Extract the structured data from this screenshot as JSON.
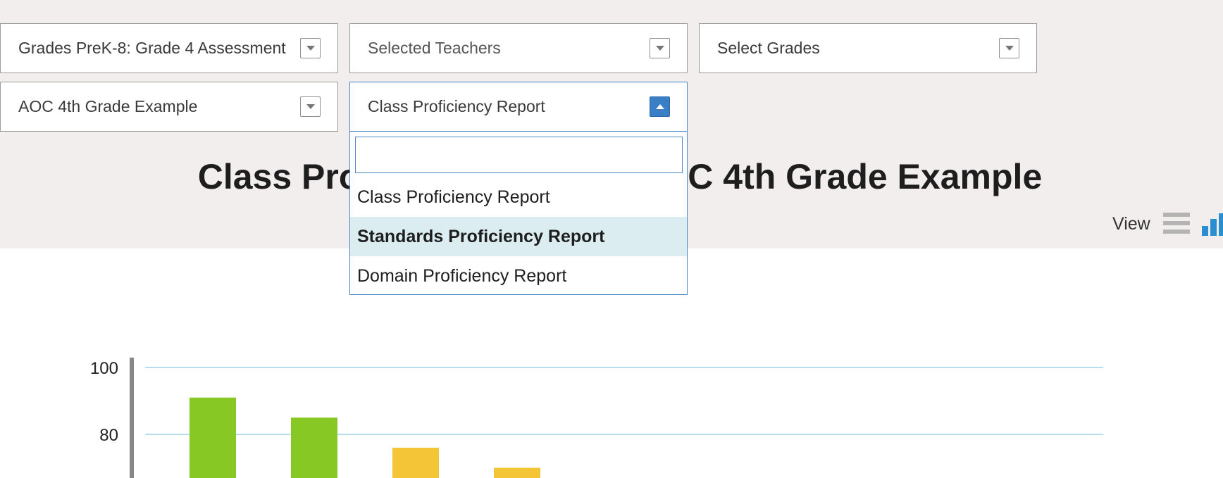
{
  "filters": {
    "assessment": "Grades PreK-8: Grade 4 Assessment",
    "teachers": "Selected Teachers",
    "grades": "Select Grades",
    "class": "AOC 4th Grade Example",
    "report": "Class Proficiency Report"
  },
  "page_title": "Class Proficiency Report: AOC 4th Grade Example",
  "view": {
    "label": "View"
  },
  "report_dropdown": {
    "search_value": "",
    "options": [
      {
        "label": "Class Proficiency Report"
      },
      {
        "label": "Standards Proficiency Report"
      },
      {
        "label": "Domain Proficiency Report"
      }
    ],
    "highlighted_index": 1
  },
  "colors": {
    "band_bg": "#f1eeed",
    "accent_blue": "#3a7fc6",
    "gridline": "#9fd6e8",
    "bar_green": "#87c824",
    "bar_yellow": "#f4c637",
    "axis": "#888888",
    "icon_gray": "#b4b4b4",
    "icon_blue": "#2a8fd0"
  },
  "chart_data": {
    "type": "bar",
    "yticks": [
      100,
      80
    ],
    "ylim": [
      0,
      100
    ],
    "bars": [
      {
        "value": 91,
        "color": "#87c824"
      },
      {
        "value": 85,
        "color": "#87c824"
      },
      {
        "value": 76,
        "color": "#f4c637"
      },
      {
        "value": 70,
        "color": "#f4c637"
      }
    ]
  }
}
